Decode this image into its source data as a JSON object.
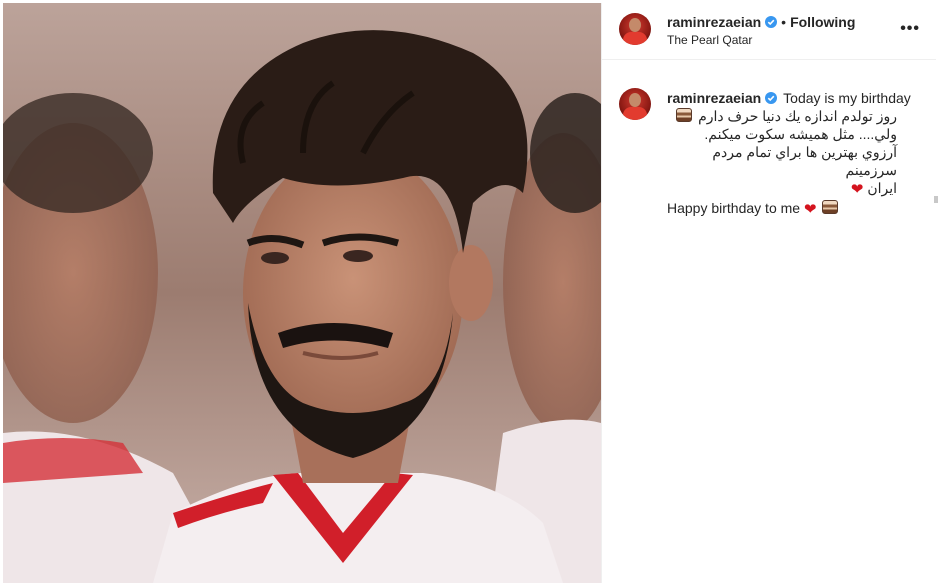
{
  "post": {
    "photo_alt": "post-photo",
    "header": {
      "username": "raminrezaeian",
      "separator": "•",
      "follow_status": "Following",
      "location": "The Pearl Qatar",
      "more_label": "•••"
    },
    "caption": {
      "username": "raminrezaeian",
      "line1": "Today is my birthday",
      "line2": "روز تولدم اندازه يك دنيا حرف دارم",
      "line3": "ولي.... مثل هميشه سكوت ميكنم.",
      "line4": "آرزوي بهترين ها براي تمام مردم سرزمينم",
      "line5": "ايران",
      "line6": "Happy birthday to me"
    },
    "icons": {
      "verified": "verified-badge-icon",
      "cake": "cake-emoji-icon",
      "heart": "red-heart-emoji-icon",
      "more": "more-options-icon"
    },
    "colors": {
      "verified": "#3897f0",
      "heart": "#d4141e",
      "text": "#262626",
      "border": "#efefef"
    }
  }
}
